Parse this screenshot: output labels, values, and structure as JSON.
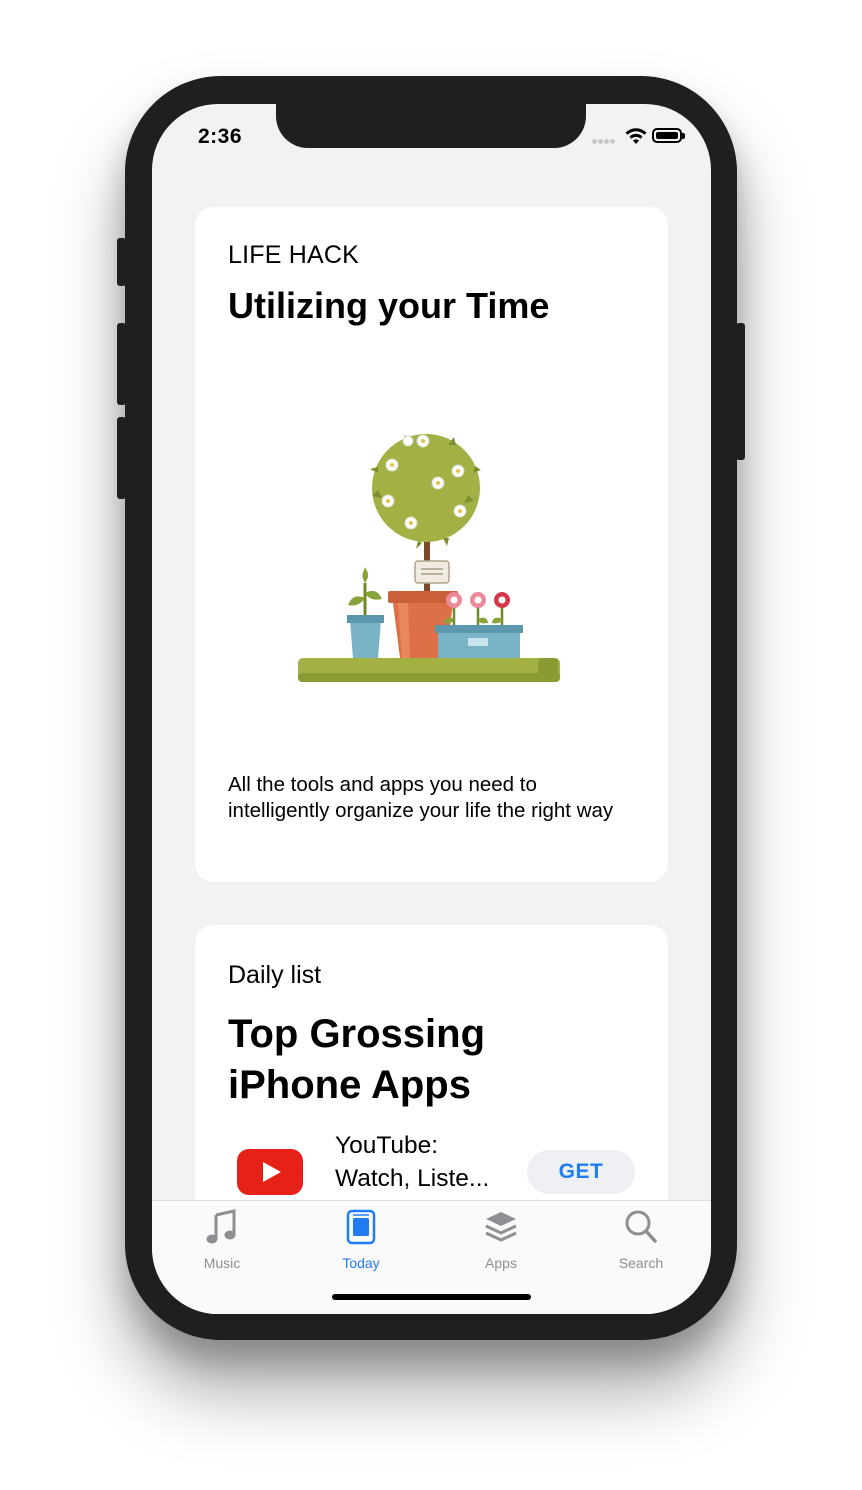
{
  "status_bar": {
    "time": "2:36"
  },
  "cards": [
    {
      "eyebrow": "LIFE HACK",
      "title": "Utilizing your Time",
      "description": "All the tools and apps you need to intelligently organize your life the right way"
    },
    {
      "eyebrow": "Daily list",
      "title": "Top Grossing iPhone Apps",
      "apps": [
        {
          "name": "YouTube: Watch, Liste...",
          "action": "GET",
          "icon": "youtube-icon"
        }
      ]
    }
  ],
  "tab_bar": {
    "items": [
      {
        "label": "Music",
        "icon": "music-note-icon"
      },
      {
        "label": "Today",
        "icon": "today-icon"
      },
      {
        "label": "Apps",
        "icon": "apps-stack-icon"
      },
      {
        "label": "Search",
        "icon": "search-icon"
      }
    ],
    "active": "Today"
  },
  "colors": {
    "accent": "#1f7cf2",
    "inactive_tab": "#8e8e93",
    "youtube_red": "#e62117"
  }
}
